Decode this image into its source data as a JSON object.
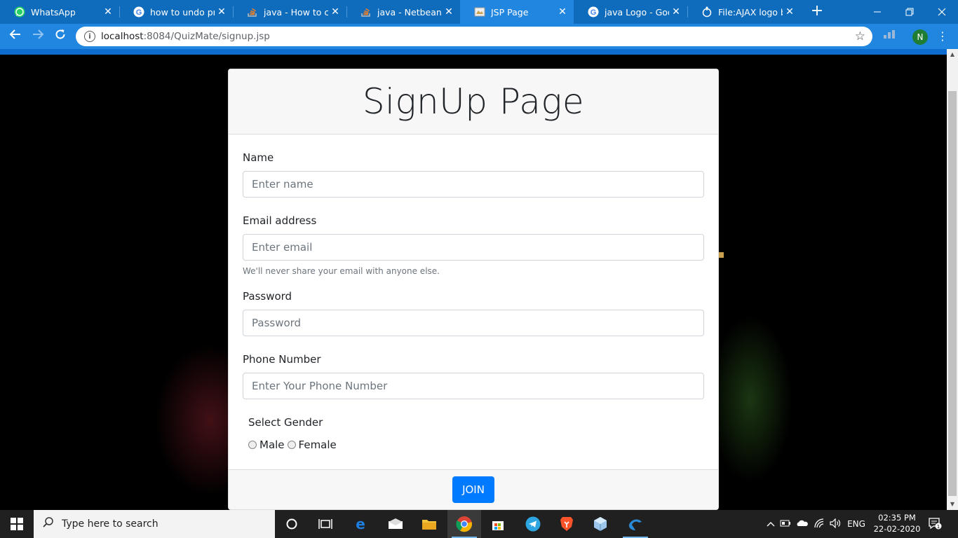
{
  "browser": {
    "tabs": [
      {
        "label": "WhatsApp",
        "icon": "whatsapp-icon"
      },
      {
        "label": "how to undo proje",
        "icon": "google-icon"
      },
      {
        "label": "java - How to com",
        "icon": "stackoverflow-icon"
      },
      {
        "label": "java - Netbeans: h",
        "icon": "stackoverflow-icon"
      },
      {
        "label": "JSP Page",
        "icon": "page-icon",
        "active": true
      },
      {
        "label": "java Logo - Googl",
        "icon": "google-icon"
      },
      {
        "label": "File:AJAX logo by ",
        "icon": "wikimedia-icon"
      }
    ],
    "address": {
      "host": "localhost",
      "path": ":8084/QuizMate/signup.jsp"
    },
    "profile_initial": "N",
    "accent": "#2186e0"
  },
  "page": {
    "title": "SignUp Page",
    "name": {
      "label": "Name",
      "placeholder": "Enter name"
    },
    "email": {
      "label": "Email address",
      "placeholder": "Enter email",
      "help": "We'll never share your email with anyone else."
    },
    "password": {
      "label": "Password",
      "placeholder": "Password"
    },
    "phone": {
      "label": "Phone Number",
      "placeholder": "Enter Your Phone Number"
    },
    "gender": {
      "label": "Select Gender",
      "options": [
        "Male",
        "Female"
      ]
    },
    "submit_label": "JOIN",
    "button_color": "#007bff"
  },
  "taskbar": {
    "search_placeholder": "Type here to search",
    "language": "ENG",
    "time": "02:35 PM",
    "date": "22-02-2020",
    "notification_count": "1"
  }
}
